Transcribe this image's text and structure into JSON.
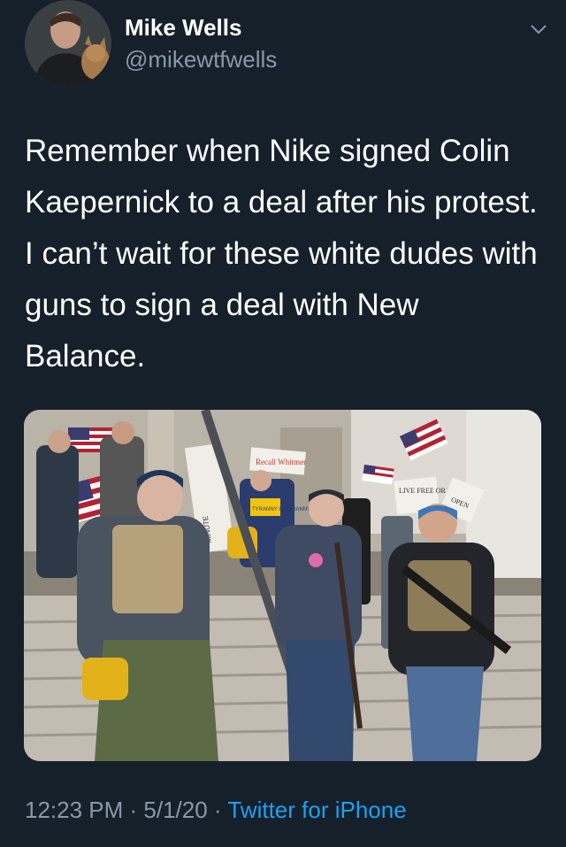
{
  "author": {
    "name": "Mike Wells",
    "handle": "@mikewtfwells",
    "avatar_icon": "user-with-cat-avatar"
  },
  "tweet": {
    "text": "Remember when Nike signed Colin Kaepernick to a deal after his protest. I can’t wait for these white dudes with guns to sign a deal with New Balance."
  },
  "media": {
    "signs": {
      "recall": "Recall Whitmer",
      "live_free": "LIVE FREE OR DIE",
      "open": "OPEN",
      "tyranny": "TYRANNY IS TYRANNY",
      "minute": "MINUTE"
    }
  },
  "meta": {
    "time": "12:23 PM",
    "sep1": " · ",
    "date": "5/1/20",
    "sep2": " · ",
    "source": "Twitter for iPhone"
  },
  "colors": {
    "background": "#15202b",
    "secondary_text": "#8899a6",
    "link": "#1da1f2"
  }
}
